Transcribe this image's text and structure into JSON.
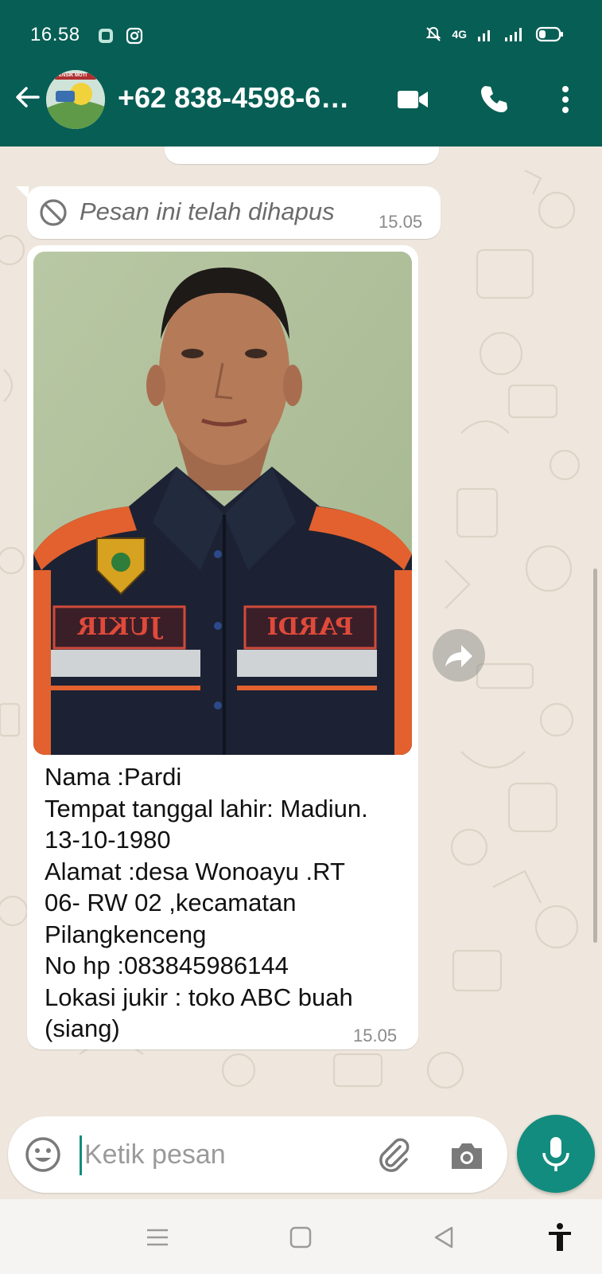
{
  "status_bar": {
    "time": "16.58",
    "network_label": "4G"
  },
  "header": {
    "contact_name": "+62 838-4598-6…",
    "avatar_label": "PENSIK MOTI",
    "icons": [
      "back-arrow-icon",
      "video-call-icon",
      "phone-icon",
      "more-vert-icon"
    ]
  },
  "chat": {
    "deleted_message": {
      "text": "Pesan ini telah dihapus",
      "time": "15.05"
    },
    "photo_message": {
      "caption_lines": [
        "Nama :Pardi",
        "Tempat tanggal lahir: Madiun.",
        "13-10-1980",
        "Alamat :desa Wonoayu .RT",
        "06- RW 02 ,kecamatan",
        "Pilangkenceng",
        "No hp :083845986144",
        "Lokasi jukir : toko ABC buah",
        "(siang)"
      ],
      "time": "15.05",
      "badge_left_text": "JUKIR",
      "badge_right_text": "PARDI"
    }
  },
  "input": {
    "placeholder": "Ketik pesan"
  },
  "colors": {
    "header": "#075e54",
    "accent": "#128c7e",
    "chat_bg": "#efe7dd"
  }
}
